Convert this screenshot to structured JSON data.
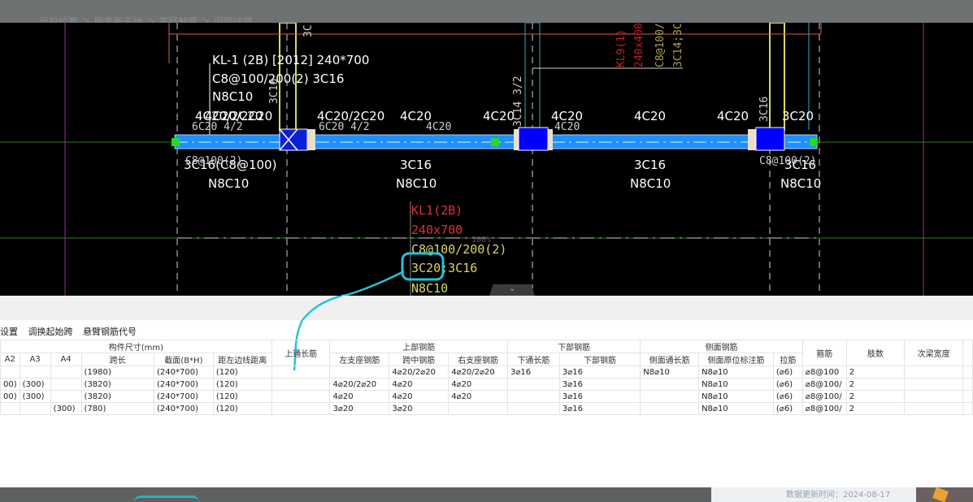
{
  "breadcrumb": "当前位置 ＞ 服务新天地 ＞ 答疑解惑 ＞ 问题详情",
  "cad": {
    "beam_title": "KL-1 (2B)  [2012] 240*700",
    "beam_stirrup": "C8@100/200(2) 3C16",
    "beam_side": "N8C10",
    "support_left": "4C20/2C20",
    "support_left_overlap": "4C20/2C20",
    "support_mid": "4C20/2C20",
    "span_top_mid": "4C20",
    "support_right_a": "4C20",
    "span_top_right": "4C20",
    "support_right_b": "4C20",
    "support_right_c": "3C20",
    "small_left": "6C20 4/2",
    "small_mid": "6C20 4/2",
    "small_span": "4C20",
    "small_right": "4C20",
    "vert_left": "3C16",
    "vert_top": "3C",
    "vert_right": "3C14 3/2",
    "vert_right2": "3C16",
    "bottom_left_a": "3C16(C8@100)",
    "bottom_left_b": "N8C10",
    "bottom_left_overlap": "C8@100(2)",
    "bottom_mid_a": "3C16",
    "bottom_mid_b": "N8C10",
    "bottom_r1_a": "3C16",
    "bottom_r1_b": "N8C10",
    "bottom_r2_a": "3C16",
    "bottom_r2_b": "N8C10",
    "bottom_r2_overlap": "C8@100(2)",
    "red_top": "KL9(1)",
    "red_top2": "240x400",
    "yellow_top": "C8@100/",
    "yellow_top2": "3C14;3C",
    "kl1_a": "KL1(2B)",
    "kl1_b": "240x700",
    "kl1_c": "C8@100/200(2)",
    "kl1_d": "3C20;3C16",
    "kl1_e": "N8C10",
    "watermark": "100%"
  },
  "panel": {
    "toolbar": [
      "设置",
      "调换起始跨",
      "悬臂钢筋代号"
    ],
    "group_headers": {
      "size": "构件尺寸(mm)",
      "top_through": "上通长筋",
      "top": "上部钢筋",
      "bottom": "下部钢筋",
      "side": "侧面钢筋",
      "stirrup": "箍筋",
      "legs": "肢数",
      "sec_width": "次梁宽度"
    },
    "sub_headers": [
      "A2",
      "A3",
      "A4",
      "跨长",
      "截面(B*H)",
      "距左边线距离",
      "左支座钢筋",
      "跨中钢筋",
      "右支座钢筋",
      "下通长筋",
      "下部钢筋",
      "侧面通长筋",
      "侧面原位标注筋",
      "拉筋"
    ],
    "rows": [
      [
        "",
        "",
        "",
        "(1980)",
        "(240*700)",
        "(120)",
        "",
        "",
        "4⌀20/2⌀20",
        "4⌀20/2⌀20",
        "3⌀16",
        "3⌀16",
        "N8⌀10",
        "N8⌀10",
        "(⌀6)",
        "⌀8@100",
        "2",
        ""
      ],
      [
        "00)",
        "(300)",
        "",
        "(3820)",
        "(240*700)",
        "(120)",
        "",
        "4⌀20/2⌀20",
        "4⌀20",
        "4⌀20",
        "",
        "3⌀16",
        "",
        "N8⌀10",
        "(⌀6)",
        "⌀8@100/",
        "2",
        ""
      ],
      [
        "00)",
        "(300)",
        "",
        "(3820)",
        "(240*700)",
        "(120)",
        "",
        "4⌀20",
        "4⌀20",
        "4⌀20",
        "",
        "3⌀16",
        "",
        "N8⌀10",
        "(⌀6)",
        "⌀8@100/",
        "2",
        ""
      ],
      [
        "",
        "",
        "(300)",
        "(780)",
        "(240*700)",
        "(120)",
        "",
        "3⌀20",
        "3⌀20",
        "",
        "",
        "3⌀16",
        "",
        "N8⌀10",
        "(⌀6)",
        "⌀8@100/",
        "2",
        ""
      ]
    ]
  },
  "footer": {
    "update_text": "数据更新时间：2024-08-17"
  },
  "colors": {
    "beam": "#1e90ff",
    "cad_bg": "#000000",
    "highlight": "#27c2d6",
    "label_white": "#ffffff",
    "label_red": "#e03030",
    "label_yellow": "#d8d860"
  }
}
